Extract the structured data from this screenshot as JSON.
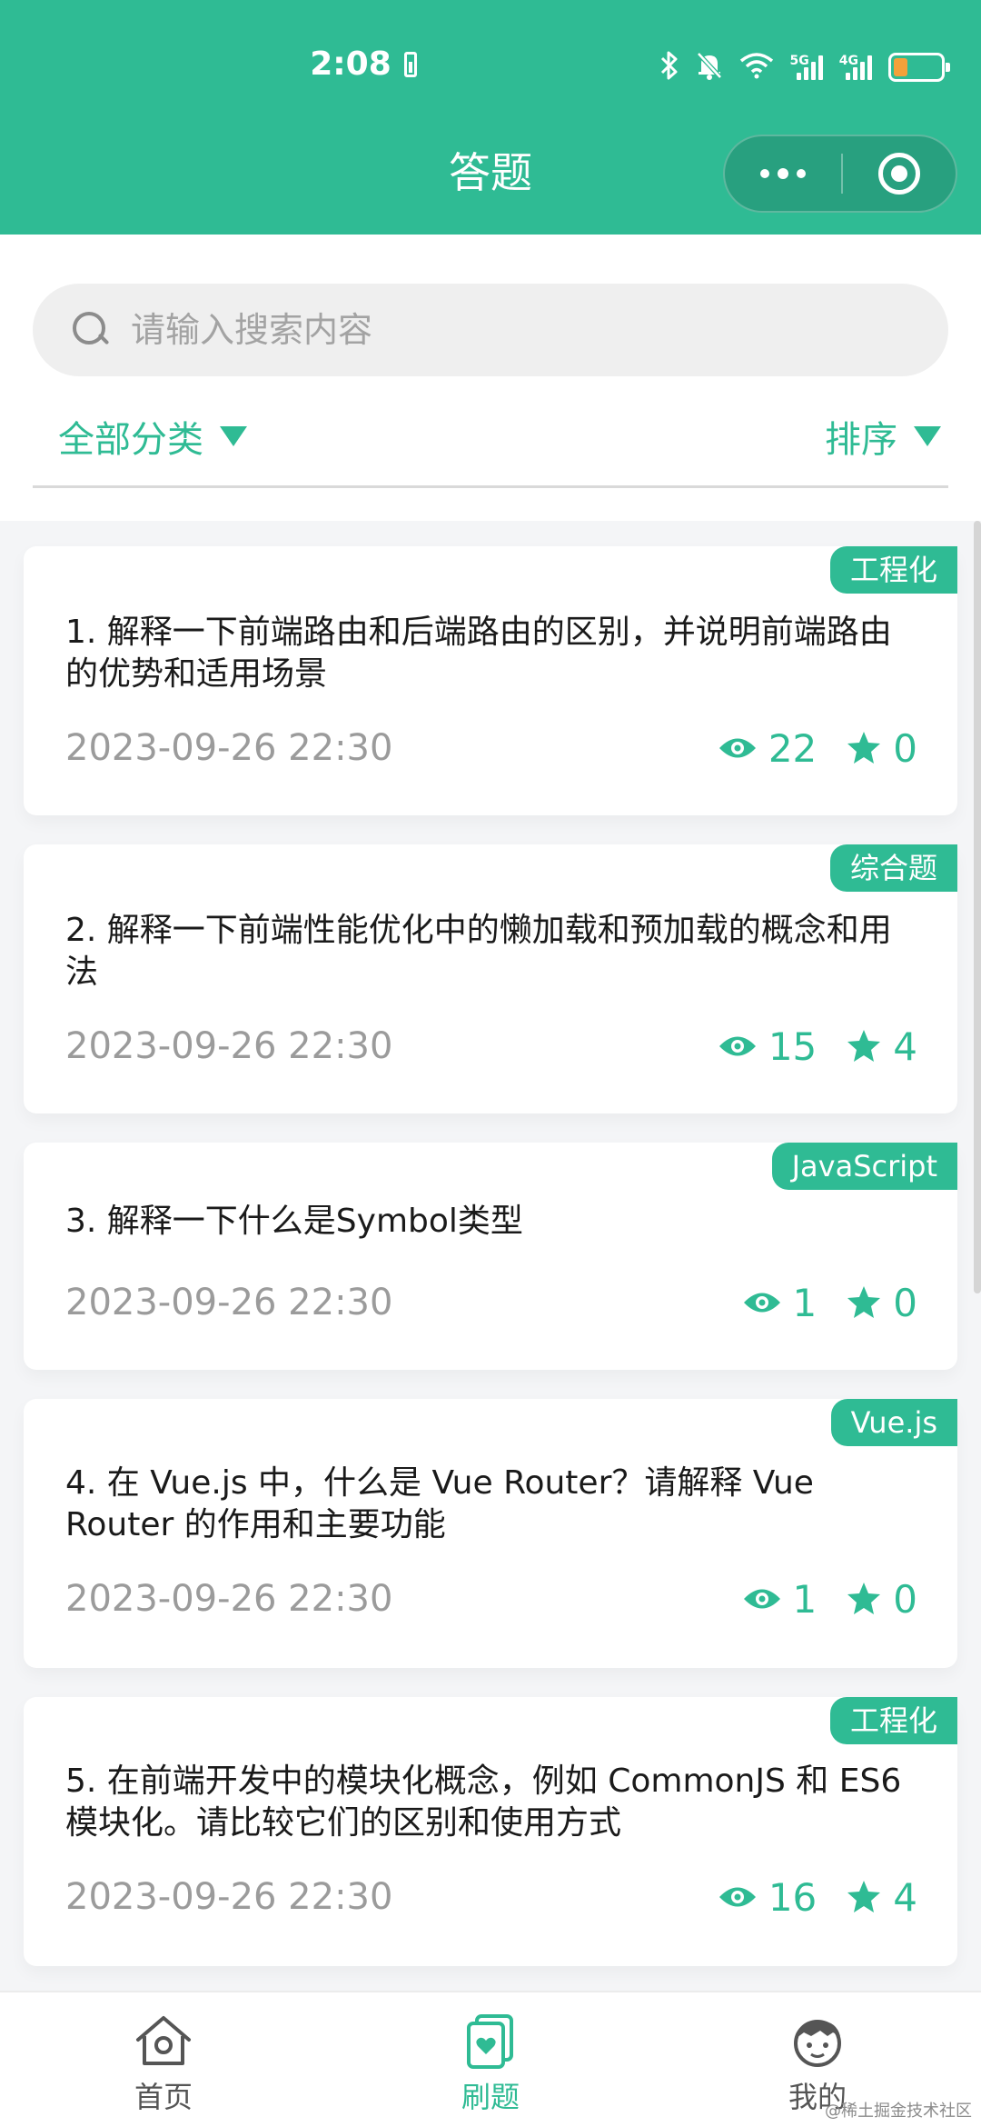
{
  "status_bar": {
    "time": "2:08",
    "network_1": "5G",
    "network_2": "4G",
    "battery_level": 0.3,
    "battery_color": "#f3a13a"
  },
  "nav": {
    "title": "答题",
    "more_icon": "more-dots-icon",
    "close_icon": "mini-program-close-icon"
  },
  "colors": {
    "accent": "#2fbb94"
  },
  "search": {
    "placeholder": "请输入搜索内容"
  },
  "filters": {
    "category": "全部分类",
    "sort": "排序"
  },
  "questions": [
    {
      "tag": "工程化",
      "title": "1. 解释一下前端路由和后端路由的区别，并说明前端路由的优势和适用场景",
      "date": "2023-09-26 22:30",
      "views": "22",
      "stars": "0"
    },
    {
      "tag": "综合题",
      "title": "2. 解释一下前端性能优化中的懒加载和预加载的概念和用法",
      "date": "2023-09-26 22:30",
      "views": "15",
      "stars": "4"
    },
    {
      "tag": "JavaScript",
      "title": "3. 解释一下什么是Symbol类型",
      "date": "2023-09-26 22:30",
      "views": "1",
      "stars": "0"
    },
    {
      "tag": "Vue.js",
      "title": "4. 在 Vue.js 中，什么是 Vue Router？请解释 Vue Router 的作用和主要功能",
      "date": "2023-09-26 22:30",
      "views": "1",
      "stars": "0"
    },
    {
      "tag": "工程化",
      "title": "5. 在前端开发中的模块化概念，例如 CommonJS 和 ES6 模块化。请比较它们的区别和使用方式",
      "date": "2023-09-26 22:30",
      "views": "16",
      "stars": "4"
    }
  ],
  "tabbar": [
    {
      "label": "首页",
      "icon": "home-icon"
    },
    {
      "label": "刷题",
      "icon": "question-bank-icon",
      "active": true
    },
    {
      "label": "我的",
      "icon": "profile-avatar-icon"
    }
  ],
  "watermark": "@稀土掘金技术社区"
}
